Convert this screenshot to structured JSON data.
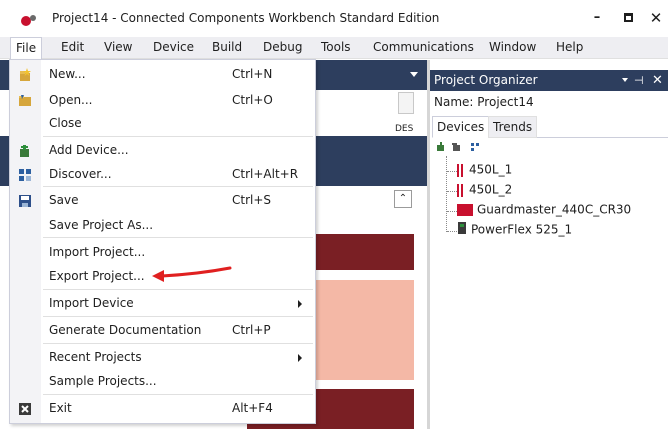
{
  "window": {
    "title": "Project14 - Connected Components Workbench Standard Edition",
    "minimize": "–",
    "close": "✕"
  },
  "menubar": [
    "File",
    "Edit",
    "View",
    "Device",
    "Build",
    "Debug",
    "Tools",
    "Communications",
    "Window",
    "Help"
  ],
  "file_menu": {
    "new": {
      "label": "New...",
      "shortcut": "Ctrl+N"
    },
    "open": {
      "label": "Open...",
      "shortcut": "Ctrl+O"
    },
    "close": {
      "label": "Close"
    },
    "add_device": {
      "label": "Add Device..."
    },
    "discover": {
      "label": "Discover...",
      "shortcut": "Ctrl+Alt+R"
    },
    "save": {
      "label": "Save",
      "shortcut": "Ctrl+S"
    },
    "save_as": {
      "label": "Save Project As..."
    },
    "import_project": {
      "label": "Import Project..."
    },
    "export_project": {
      "label": "Export Project..."
    },
    "import_device": {
      "label": "Import Device"
    },
    "generate_docs": {
      "label": "Generate Documentation",
      "shortcut": "Ctrl+P"
    },
    "recent_projects": {
      "label": "Recent Projects"
    },
    "sample_projects": {
      "label": "Sample Projects..."
    },
    "exit": {
      "label": "Exit",
      "shortcut": "Alt+F4"
    }
  },
  "editor": {
    "des_label": "DES",
    "collapse_glyph": "⌃"
  },
  "project_organizer": {
    "title": "Project Organizer",
    "pin": "▾ ⊣",
    "close": "✕",
    "name_label": "Name:",
    "name_value": "Project14",
    "tabs": [
      "Devices",
      "Trends"
    ],
    "devices": [
      "450L_1",
      "450L_2",
      "Guardmaster_440C_CR30",
      "PowerFlex 525_1"
    ]
  },
  "colors": {
    "accent_navy": "#2d3e5e",
    "maroon": "#7a1f24",
    "salmon": "#f4b8a6",
    "annotation_red": "#e02020"
  }
}
